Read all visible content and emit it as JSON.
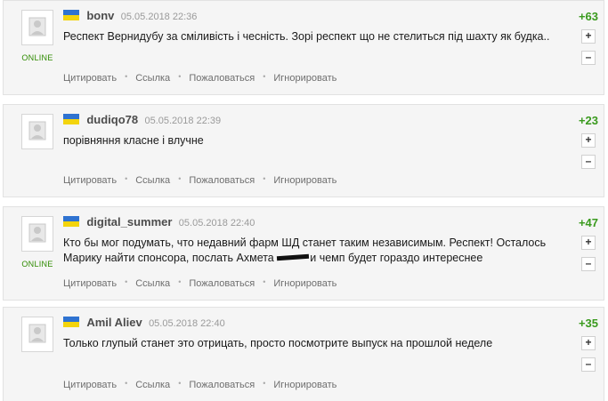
{
  "actions": {
    "quote": "Цитировать",
    "link": "Ссылка",
    "report": "Пожаловаться",
    "ignore": "Игнорировать",
    "separator": "•"
  },
  "vote_plus": "+",
  "vote_minus": "–",
  "comments": [
    {
      "user": "bonv",
      "date": "05.05.2018 22:36",
      "text": "Респект Вернидубу за сміливість і чесність. Зорі респект що не стелиться під шахту як будка..",
      "rating": "+63",
      "status": "ONLINE"
    },
    {
      "user": "dudiqo78",
      "date": "05.05.2018 22:39",
      "text": "порівняння класне і влучне",
      "rating": "+23",
      "status": ""
    },
    {
      "user": "digital_summer",
      "date": "05.05.2018 22:40",
      "text_part1": "Кто бы мог подумать, что недавний фарм ШД станет таким независимым. Респект! Осталось Марику найти спонсора, послать Ахмета",
      "text_part2": "и чемп будет гораздо интереснее",
      "rating": "+47",
      "status": "ONLINE"
    },
    {
      "user": "Amil Aliev",
      "date": "05.05.2018 22:40",
      "text": "Только глупый станет это отрицать, просто посмотрите выпуск на прошлой неделе",
      "rating": "+35",
      "status": ""
    }
  ],
  "colors": {
    "rating": "#3a9a1e",
    "online": "#2e8b00",
    "flag_blue": "#2f73d1",
    "flag_yellow": "#f3d40d"
  }
}
